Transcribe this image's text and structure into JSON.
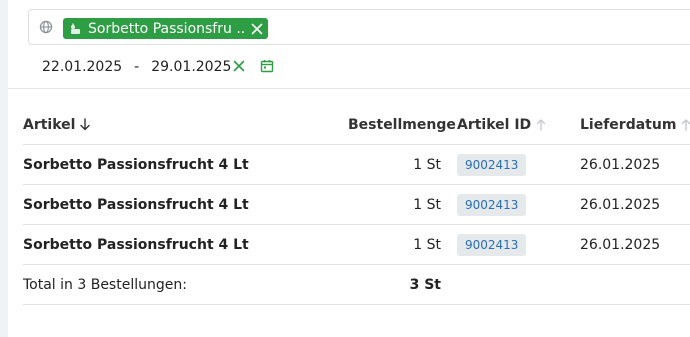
{
  "filter": {
    "chip_label": "Sorbetto Passionsfru ...",
    "date_from": "22.01.2025",
    "date_sep": "-",
    "date_to": "29.01.2025"
  },
  "colors": {
    "chip_green": "#2e9e45",
    "link_blue": "#2a6fb5",
    "icon_green": "#2e9e45"
  },
  "table": {
    "headers": {
      "artikel": "Artikel",
      "bestellmenge": "Bestellmenge",
      "artikel_id": "Artikel ID",
      "lieferdatum": "Lieferdatum"
    },
    "rows": [
      {
        "name": "Sorbetto Passionsfrucht 4 Lt",
        "qty": "1 St",
        "id": "9002413",
        "date": "26.01.2025"
      },
      {
        "name": "Sorbetto Passionsfrucht 4 Lt",
        "qty": "1 St",
        "id": "9002413",
        "date": "26.01.2025"
      },
      {
        "name": "Sorbetto Passionsfrucht 4 Lt",
        "qty": "1 St",
        "id": "9002413",
        "date": "26.01.2025"
      }
    ],
    "total": {
      "label": "Total in 3 Bestellungen:",
      "qty": "3 St"
    }
  },
  "icons": {
    "globe": "globe-icon",
    "chip_lead": "ice-cream-icon",
    "chip_close": "close-icon",
    "date_clear": "close-icon",
    "calendar": "calendar-icon",
    "sort_down": "arrow-down-icon",
    "sort_up": "arrow-up-icon"
  }
}
